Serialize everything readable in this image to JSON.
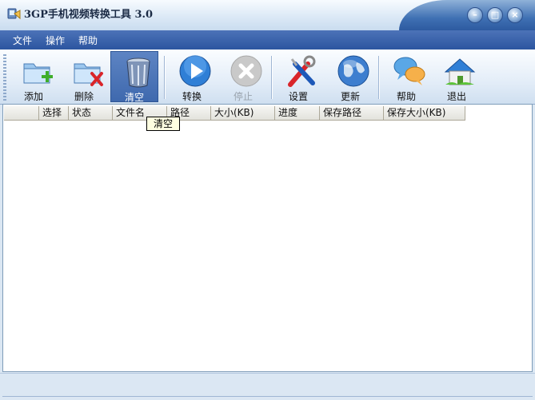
{
  "window": {
    "title": "3GP手机视频转换工具 3.0",
    "controls": {
      "minimize": "–",
      "maximize": "□",
      "close": "×"
    }
  },
  "menu": [
    "文件",
    "操作",
    "帮助"
  ],
  "toolbar": [
    {
      "label": "添加",
      "icon": "add-folder-icon",
      "state": "normal"
    },
    {
      "label": "删除",
      "icon": "delete-folder-icon",
      "state": "normal"
    },
    {
      "label": "清空",
      "icon": "trash-can-icon",
      "state": "active"
    },
    {
      "label": "转换",
      "icon": "play-icon",
      "state": "normal"
    },
    {
      "label": "停止",
      "icon": "stop-icon",
      "state": "disabled"
    },
    {
      "label": "设置",
      "icon": "tools-icon",
      "state": "normal"
    },
    {
      "label": "更新",
      "icon": "globe-icon",
      "state": "normal"
    },
    {
      "label": "帮助",
      "icon": "chat-bubbles-icon",
      "state": "normal"
    },
    {
      "label": "退出",
      "icon": "house-icon",
      "state": "normal"
    }
  ],
  "columns": [
    "",
    "选择",
    "状态",
    "文件名",
    "路径",
    "大小(KB)",
    "进度",
    "保存路径",
    "保存大小(KB)"
  ],
  "tooltip": "清空",
  "colors": {
    "menubar": "#2c55a0",
    "accent": "#3f69ae",
    "background": "#dbe7f3"
  }
}
